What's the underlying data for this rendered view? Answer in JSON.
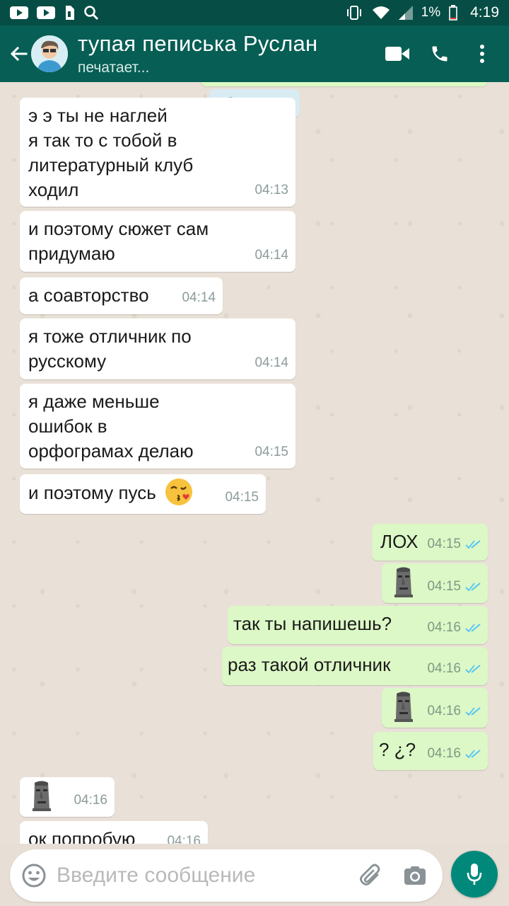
{
  "status_bar": {
    "battery_percent": "1%",
    "time": "4:19",
    "left_icons": [
      "youtube-icon",
      "youtube-icon",
      "sim-toolkit-icon",
      "search-icon"
    ],
    "right_icons": [
      "vibrate-icon",
      "wifi-icon",
      "signal-icon",
      "battery-icon"
    ]
  },
  "header": {
    "contact_name": "тупая пеписька Руслан",
    "contact_status": "печатает...",
    "color": "#075e54"
  },
  "chat": {
    "date_chip": "Сегодня",
    "messages": [
      {
        "dir": "in",
        "text": "э э ты не наглей\nя так то с тобой в\nлитературный клуб\nходил",
        "time": "04:13"
      },
      {
        "dir": "in",
        "text": "и поэтому сюжет сам\nпридумаю",
        "time": "04:14"
      },
      {
        "dir": "in",
        "text": "а соавторство",
        "time": "04:14"
      },
      {
        "dir": "in",
        "text": "я тоже отличник по\nрусскому",
        "time": "04:14"
      },
      {
        "dir": "in",
        "text": " я даже меньше\nошибок в\nорфограмах делаю",
        "time": "04:15"
      },
      {
        "dir": "in",
        "text": "и поэтому пусь",
        "emoji": "kissing-heart-emoji",
        "time": "04:15"
      },
      {
        "dir": "out",
        "text": "ЛОХ",
        "time": "04:15",
        "status": "read"
      },
      {
        "dir": "out",
        "emoji": "moai-emoji",
        "time": "04:15",
        "status": "read"
      },
      {
        "dir": "out",
        "text": "так ты напишешь?",
        "time": "04:16",
        "status": "read"
      },
      {
        "dir": "out",
        "text": "раз такой отличник",
        "time": "04:16",
        "status": "read"
      },
      {
        "dir": "out",
        "emoji": "moai-emoji",
        "time": "04:16",
        "status": "read"
      },
      {
        "dir": "out",
        "text": "? ¿?",
        "time": "04:16",
        "status": "read"
      },
      {
        "dir": "in",
        "emoji": "moai-emoji",
        "time": "04:16"
      },
      {
        "dir": "in",
        "text": "ок попробую",
        "time": "04:16"
      }
    ]
  },
  "composer": {
    "placeholder": "Введите сообщение"
  },
  "colors": {
    "incoming_bubble": "#ffffff",
    "outgoing_bubble": "#dcf8c6",
    "read_ticks": "#4fc3f7",
    "mic_button": "#00897b"
  }
}
